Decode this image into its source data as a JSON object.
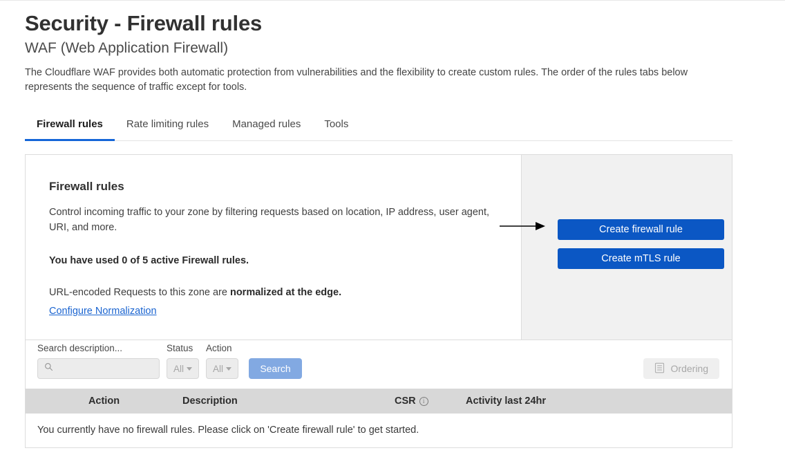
{
  "header": {
    "title": "Security - Firewall rules",
    "subtitle": "WAF (Web Application Firewall)",
    "description": "The Cloudflare WAF provides both automatic protection from vulnerabilities and the flexibility to create custom rules. The order of the rules tabs below represents the sequence of traffic except for tools."
  },
  "tabs": [
    {
      "label": "Firewall rules",
      "active": true
    },
    {
      "label": "Rate limiting rules",
      "active": false
    },
    {
      "label": "Managed rules",
      "active": false
    },
    {
      "label": "Tools",
      "active": false
    }
  ],
  "card": {
    "heading": "Firewall rules",
    "body": "Control incoming traffic to your zone by filtering requests based on location, IP address, user agent, URI, and more.",
    "quota": "You have used 0 of 5 active Firewall rules.",
    "normalization_prefix": "URL-encoded Requests to this zone are ",
    "normalization_bold": "normalized at the edge.",
    "link_label": "Configure Normalization",
    "buttons": [
      {
        "label": "Create firewall rule",
        "name": "create-firewall-rule-button"
      },
      {
        "label": "Create mTLS rule",
        "name": "create-mtls-rule-button"
      }
    ]
  },
  "filters": {
    "search_label": "Search description...",
    "search_value": "",
    "search_placeholder": "",
    "status_label": "Status",
    "status_value": "All",
    "action_label": "Action",
    "action_value": "All",
    "search_button": "Search",
    "ordering_button": "Ordering"
  },
  "table": {
    "columns": [
      "Action",
      "Description",
      "CSR",
      "Activity last 24hr"
    ],
    "csr_info_glyph": "i",
    "empty_message": "You currently have no firewall rules. Please click on 'Create firewall rule' to get started.",
    "rows": []
  },
  "colors": {
    "primary_blue": "#0b57c4",
    "tab_underline": "#1466d8",
    "link_blue": "#1a64d0",
    "search_button_disabled": "#82a9e2",
    "panel_gray": "#f1f1f1",
    "table_header_gray": "#d8d8d8"
  },
  "annotation": {
    "arrow": "arrow pointing right at Create firewall rule button"
  }
}
